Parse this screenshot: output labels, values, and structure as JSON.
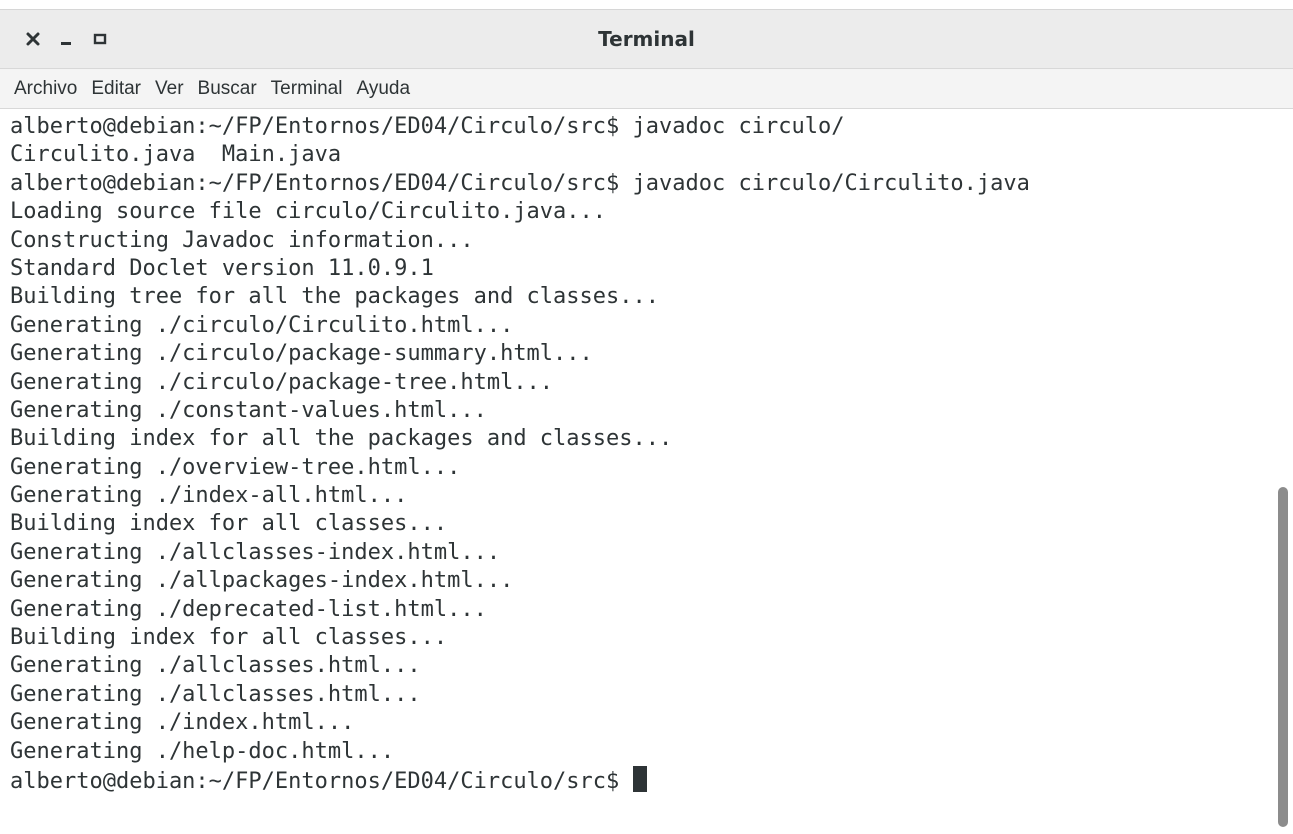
{
  "window": {
    "title": "Terminal"
  },
  "titlebar": {
    "close_icon": "close-x-icon",
    "minimize_icon": "minimize-icon",
    "maximize_icon": "maximize-icon"
  },
  "menu": {
    "items": [
      "Archivo",
      "Editar",
      "Ver",
      "Buscar",
      "Terminal",
      "Ayuda"
    ]
  },
  "terminal": {
    "lines": [
      "alberto@debian:~/FP/Entornos/ED04/Circulo/src$ javadoc circulo/",
      "Circulito.java  Main.java",
      "alberto@debian:~/FP/Entornos/ED04/Circulo/src$ javadoc circulo/Circulito.java",
      "Loading source file circulo/Circulito.java...",
      "Constructing Javadoc information...",
      "Standard Doclet version 11.0.9.1",
      "Building tree for all the packages and classes...",
      "Generating ./circulo/Circulito.html...",
      "Generating ./circulo/package-summary.html...",
      "Generating ./circulo/package-tree.html...",
      "Generating ./constant-values.html...",
      "Building index for all the packages and classes...",
      "Generating ./overview-tree.html...",
      "Generating ./index-all.html...",
      "Building index for all classes...",
      "Generating ./allclasses-index.html...",
      "Generating ./allpackages-index.html...",
      "Generating ./deprecated-list.html...",
      "Building index for all classes...",
      "Generating ./allclasses.html...",
      "Generating ./allclasses.html...",
      "Generating ./index.html...",
      "Generating ./help-doc.html..."
    ],
    "prompt": "alberto@debian:~/FP/Entornos/ED04/Circulo/src$ "
  },
  "colors": {
    "text": "#2e3436",
    "titlebar": "#ececec",
    "menubar": "#f4f4f4",
    "background": "#ffffff",
    "scrollbar": "#8c8c8c"
  }
}
